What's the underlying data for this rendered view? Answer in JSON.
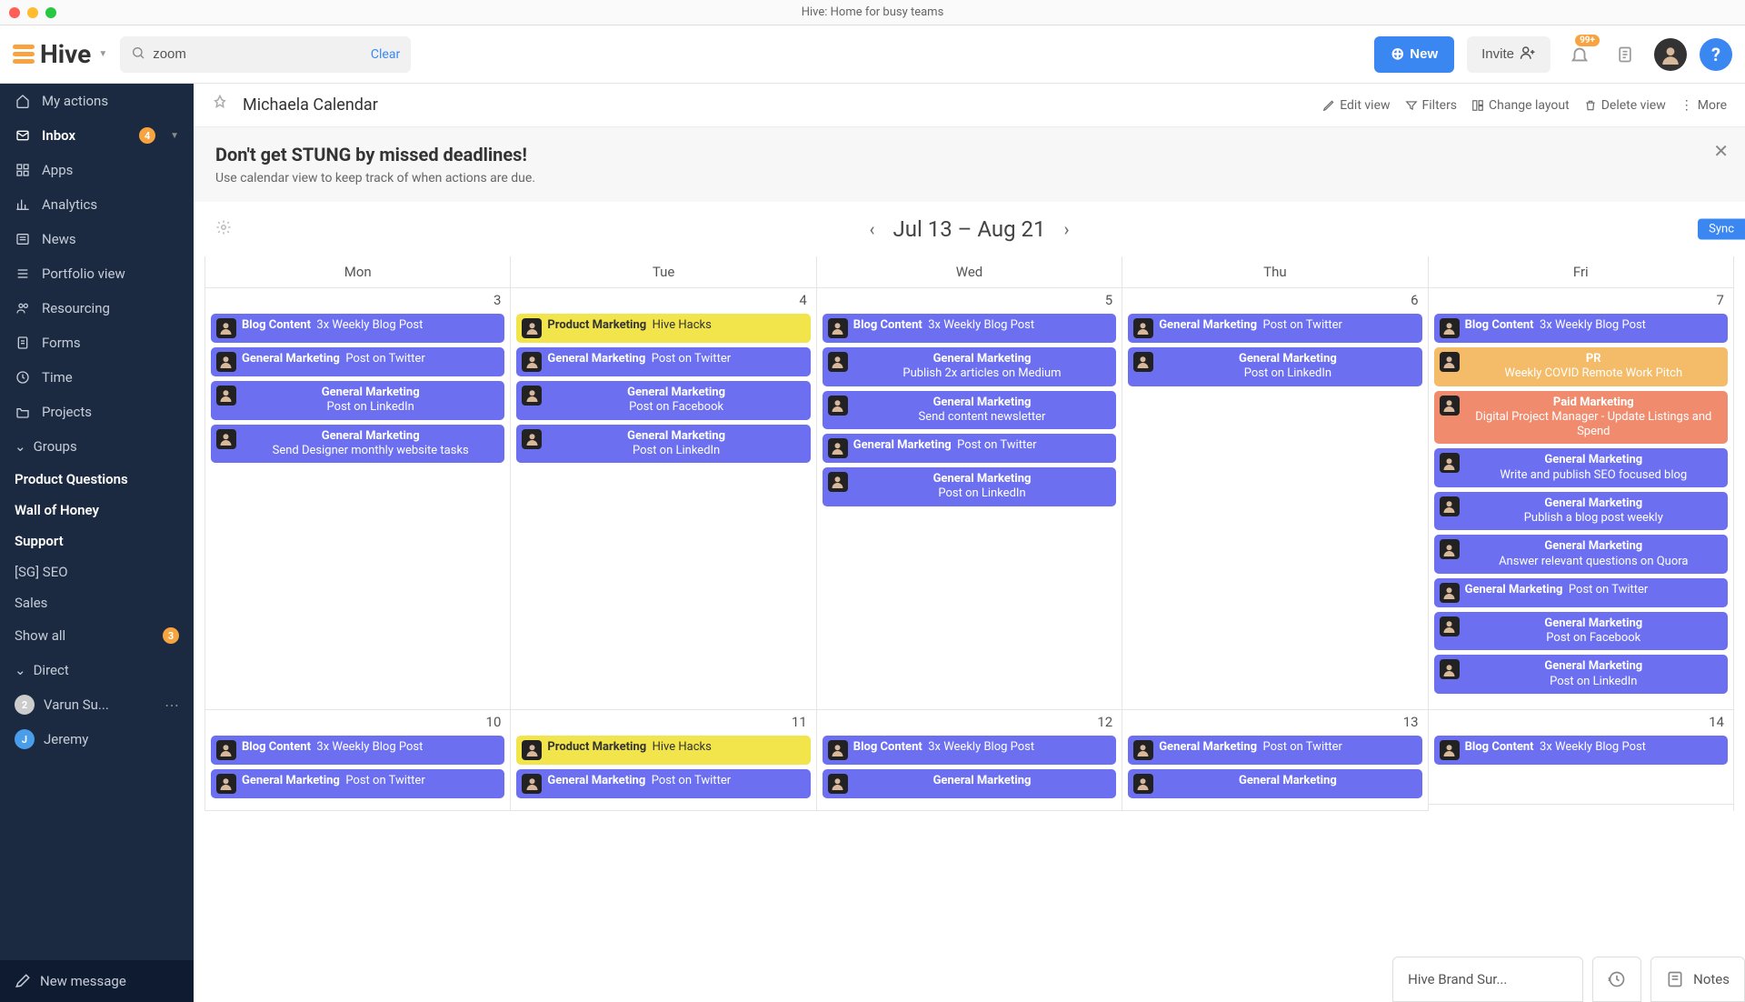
{
  "window_title": "Hive: Home for busy teams",
  "logo": "Hive",
  "search": {
    "value": "zoom",
    "clear": "Clear"
  },
  "topbar": {
    "new": "New",
    "invite": "Invite",
    "notif_badge": "99+"
  },
  "sidebar": {
    "nav": [
      {
        "icon": "home",
        "label": "My actions"
      },
      {
        "icon": "mail",
        "label": "Inbox",
        "bold": true,
        "badge": "4",
        "chevron": true
      },
      {
        "icon": "apps",
        "label": "Apps"
      },
      {
        "icon": "chart",
        "label": "Analytics"
      },
      {
        "icon": "news",
        "label": "News"
      },
      {
        "icon": "portfolio",
        "label": "Portfolio view"
      },
      {
        "icon": "resourcing",
        "label": "Resourcing"
      },
      {
        "icon": "forms",
        "label": "Forms"
      },
      {
        "icon": "time",
        "label": "Time"
      },
      {
        "icon": "projects",
        "label": "Projects"
      }
    ],
    "groups_label": "Groups",
    "groups": [
      {
        "label": "Product Questions",
        "bold": true
      },
      {
        "label": "Wall of Honey",
        "bold": true
      },
      {
        "label": "Support",
        "bold": true
      },
      {
        "label": "[SG] SEO",
        "bold": false
      },
      {
        "label": "Sales",
        "bold": false
      }
    ],
    "show_all": {
      "label": "Show all",
      "badge": "3"
    },
    "direct_label": "Direct",
    "dms": [
      {
        "initial": "2",
        "color": "#ccc",
        "label": "Varun Su...",
        "dots": true
      },
      {
        "initial": "J",
        "color": "#4a9de8",
        "label": "Jeremy"
      }
    ],
    "new_message": "New message"
  },
  "toolbar": {
    "view_title": "Michaela Calendar",
    "actions": [
      "Edit view",
      "Filters",
      "Change layout",
      "Delete view",
      "More"
    ]
  },
  "banner": {
    "headline": "Don't get STUNG by missed deadlines!",
    "sub": "Use calendar view to keep track of when actions are due."
  },
  "calendar": {
    "range": "Jul 13 – Aug 21",
    "sync": "Sync",
    "days": [
      "Mon",
      "Tue",
      "Wed",
      "Thu",
      "Fri"
    ],
    "row1_nums": [
      "3",
      "4",
      "5",
      "6",
      "7"
    ],
    "row2_nums": [
      "10",
      "11",
      "12",
      "13",
      "14"
    ],
    "row1": [
      [
        {
          "c": "purple",
          "cat": "Blog Content",
          "title": "3x Weekly Blog Post",
          "inline": true
        },
        {
          "c": "purple",
          "cat": "General Marketing",
          "title": "Post on Twitter",
          "inline": true
        },
        {
          "c": "purple",
          "cat": "General Marketing",
          "title": "Post on LinkedIn",
          "center": true
        },
        {
          "c": "purple",
          "cat": "General Marketing",
          "title": "Send Designer monthly website tasks",
          "center": true
        }
      ],
      [
        {
          "c": "yellow",
          "cat": "Product Marketing",
          "title": "Hive Hacks",
          "inline": true
        },
        {
          "c": "purple",
          "cat": "General Marketing",
          "title": "Post on Twitter",
          "inline": true
        },
        {
          "c": "purple",
          "cat": "General Marketing",
          "title": "Post on Facebook",
          "center": true
        },
        {
          "c": "purple",
          "cat": "General Marketing",
          "title": "Post on LinkedIn",
          "center": true
        }
      ],
      [
        {
          "c": "purple",
          "cat": "Blog Content",
          "title": "3x Weekly Blog Post",
          "inline": true
        },
        {
          "c": "purple",
          "cat": "General Marketing",
          "title": "Publish 2x articles on Medium",
          "center": true
        },
        {
          "c": "purple",
          "cat": "General Marketing",
          "title": "Send content newsletter",
          "center": true
        },
        {
          "c": "purple",
          "cat": "General Marketing",
          "title": "Post on Twitter",
          "inline": true
        },
        {
          "c": "purple",
          "cat": "General Marketing",
          "title": "Post on LinkedIn",
          "center": true
        }
      ],
      [
        {
          "c": "purple",
          "cat": "General Marketing",
          "title": "Post on Twitter",
          "inline": true
        },
        {
          "c": "purple",
          "cat": "General Marketing",
          "title": "Post on LinkedIn",
          "center": true
        }
      ],
      [
        {
          "c": "purple",
          "cat": "Blog Content",
          "title": "3x Weekly Blog Post",
          "inline": true
        },
        {
          "c": "amber",
          "cat": "PR",
          "title": "Weekly COVID Remote Work Pitch",
          "center": true
        },
        {
          "c": "salmon",
          "cat": "Paid Marketing",
          "title": "Digital Project Manager - Update Listings and Spend",
          "center": true
        },
        {
          "c": "purple",
          "cat": "General Marketing",
          "title": "Write and publish SEO focused blog",
          "center": true
        },
        {
          "c": "purple",
          "cat": "General Marketing",
          "title": "Publish a blog post weekly",
          "center": true
        },
        {
          "c": "purple",
          "cat": "General Marketing",
          "title": "Answer relevant questions on Quora",
          "center": true
        },
        {
          "c": "purple",
          "cat": "General Marketing",
          "title": "Post on Twitter",
          "inline": true
        },
        {
          "c": "purple",
          "cat": "General Marketing",
          "title": "Post on Facebook",
          "center": true
        },
        {
          "c": "purple",
          "cat": "General Marketing",
          "title": "Post on LinkedIn",
          "center": true
        }
      ]
    ],
    "row2": [
      [
        {
          "c": "purple",
          "cat": "Blog Content",
          "title": "3x Weekly Blog Post",
          "inline": true
        },
        {
          "c": "purple",
          "cat": "General Marketing",
          "title": "Post on Twitter",
          "inline": true
        }
      ],
      [
        {
          "c": "yellow",
          "cat": "Product Marketing",
          "title": "Hive Hacks",
          "inline": true
        },
        {
          "c": "purple",
          "cat": "General Marketing",
          "title": "Post on Twitter",
          "inline": true
        }
      ],
      [
        {
          "c": "purple",
          "cat": "Blog Content",
          "title": "3x Weekly Blog Post",
          "inline": true
        },
        {
          "c": "purple",
          "cat": "General Marketing",
          "title": "",
          "center": true
        }
      ],
      [
        {
          "c": "purple",
          "cat": "General Marketing",
          "title": "Post on Twitter",
          "inline": true
        },
        {
          "c": "purple",
          "cat": "General Marketing",
          "title": "",
          "center": true
        }
      ],
      [
        {
          "c": "purple",
          "cat": "Blog Content",
          "title": "3x Weekly Blog Post",
          "inline": true
        }
      ]
    ]
  },
  "tray": {
    "doc": "Hive Brand Sur...",
    "notes": "Notes"
  }
}
